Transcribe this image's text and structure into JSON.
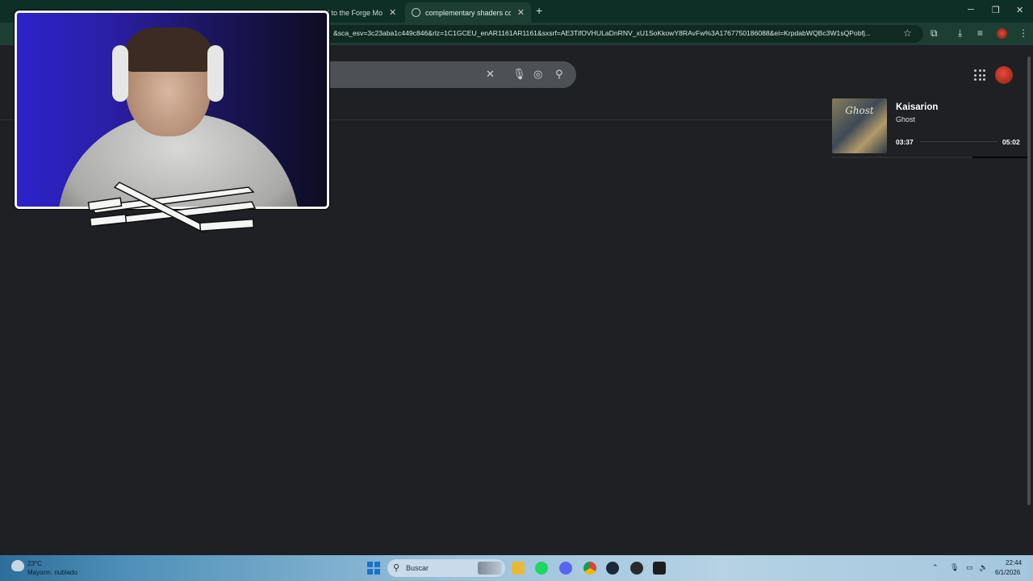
{
  "browser": {
    "tabs": [
      {
        "label": "d to the Forge Mo",
        "active": false
      },
      {
        "label": "complementary shaders como",
        "active": true
      }
    ],
    "new_tab": "+",
    "url": "&sca_esv=3c23aba1c449c846&rlz=1C1GCEU_enAR1161AR1161&sxsrf=AE3TifOVHULaDnRNV_xU1SoKkowY8RAvFw%3A1767750186088&ei=KrpdabWQBc3W1sQPobfj..."
  },
  "now_playing": {
    "title": "Kaisarion",
    "artist": "Ghost",
    "album_logo": "Ghost",
    "elapsed": "03:37",
    "duration": "05:02",
    "progress": 0.72
  },
  "taskbar": {
    "weather_temp": "23°C",
    "weather_desc": "Mayorm. nublado",
    "search_label": "Buscar",
    "time": "22:44",
    "date": "6/1/2026"
  },
  "colors": {
    "tabstrip": "#0e2f25",
    "toolbar": "#1d3f33",
    "page_bg": "#1f2023",
    "search_bg": "#4d5156"
  }
}
